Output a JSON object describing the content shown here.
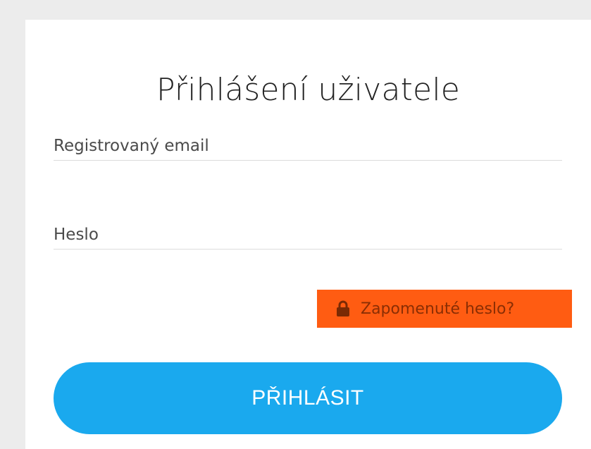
{
  "login": {
    "title": "Přihlášení uživatele",
    "email_placeholder": "Registrovaný email",
    "email_value": "",
    "password_placeholder": "Heslo",
    "password_value": "",
    "forgot_password_label": "Zapomenuté heslo?",
    "forgot_password_icon": "lock-icon",
    "submit_label": "PŘIHLÁSIT"
  },
  "colors": {
    "page_background": "#ececec",
    "card_background": "#ffffff",
    "button_accent": "#1aa9ee",
    "forgot_highlight": "#ff5c12",
    "forgot_text": "#8a2e04"
  }
}
